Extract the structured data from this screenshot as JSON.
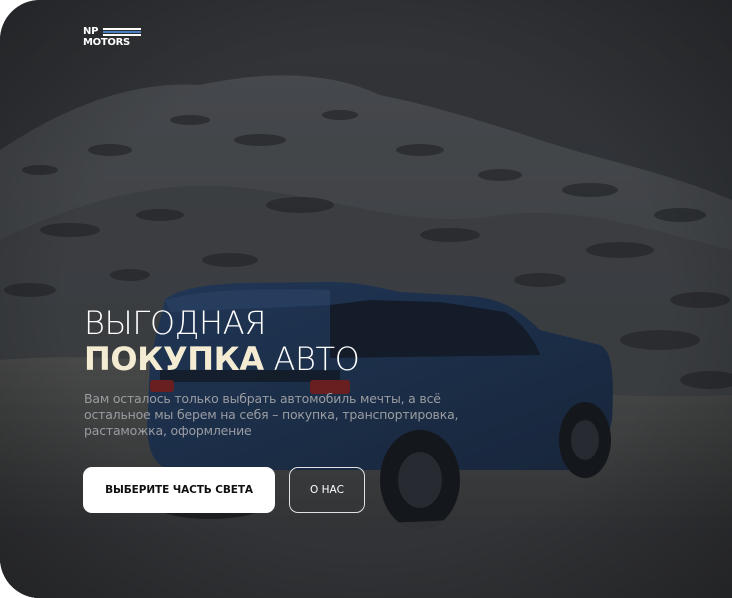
{
  "logo": {
    "line1": "NP",
    "line2": "MOTORS",
    "stripe_colors": [
      "#ffffff",
      "#4a7fc1",
      "#ffffff"
    ]
  },
  "hero": {
    "title_line1": "ВЫГОДНАЯ",
    "title_accent": "ПОКУПКА",
    "title_rest": " АВТО",
    "subtitle": "Вам осталось только выбрать автомобиль мечты, а всё остальное мы берем на себя – покупка, транспортировка, растаможка, оформление",
    "background_image": "snowy-mountain-blue-suv"
  },
  "buttons": {
    "primary_label": "ВЫБЕРИТЕ ЧАСТЬ СВЕТА",
    "secondary_label": "О НАС"
  },
  "colors": {
    "accent": "#f3ecd2",
    "overlay": "#2b2d31",
    "car": "#1f3a66"
  }
}
